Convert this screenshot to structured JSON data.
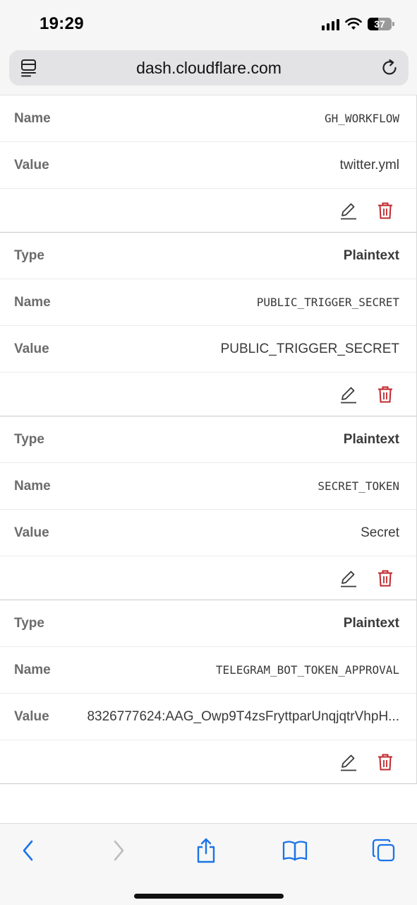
{
  "status": {
    "time": "19:29",
    "battery": "37"
  },
  "browser": {
    "url": "dash.cloudflare.com"
  },
  "variables": [
    {
      "name_label": "Name",
      "name": "GH_WORKFLOW",
      "value_label": "Value",
      "value": "twitter.yml"
    },
    {
      "type_label": "Type",
      "type": "Plaintext",
      "name_label": "Name",
      "name": "PUBLIC_TRIGGER_SECRET",
      "value_label": "Value",
      "value": "PUBLIC_TRIGGER_SECRET"
    },
    {
      "type_label": "Type",
      "type": "Plaintext",
      "name_label": "Name",
      "name": "SECRET_TOKEN",
      "value_label": "Value",
      "value": "Secret"
    },
    {
      "type_label": "Type",
      "type": "Plaintext",
      "name_label": "Name",
      "name": "TELEGRAM_BOT_TOKEN_APPROVAL",
      "value_label": "Value",
      "value": "8326777624:AAG_Owp9T4zsFryttparUnqjqtrVhpH..."
    }
  ],
  "colors": {
    "delete": "#c0282d",
    "accent": "#1a73e8"
  },
  "icons": {
    "edit": "pencil-icon",
    "delete": "trash-icon",
    "back": "chevron-left-icon",
    "forward": "chevron-right-icon",
    "share": "share-icon",
    "bookmarks": "book-icon",
    "tabs": "tabs-icon"
  }
}
